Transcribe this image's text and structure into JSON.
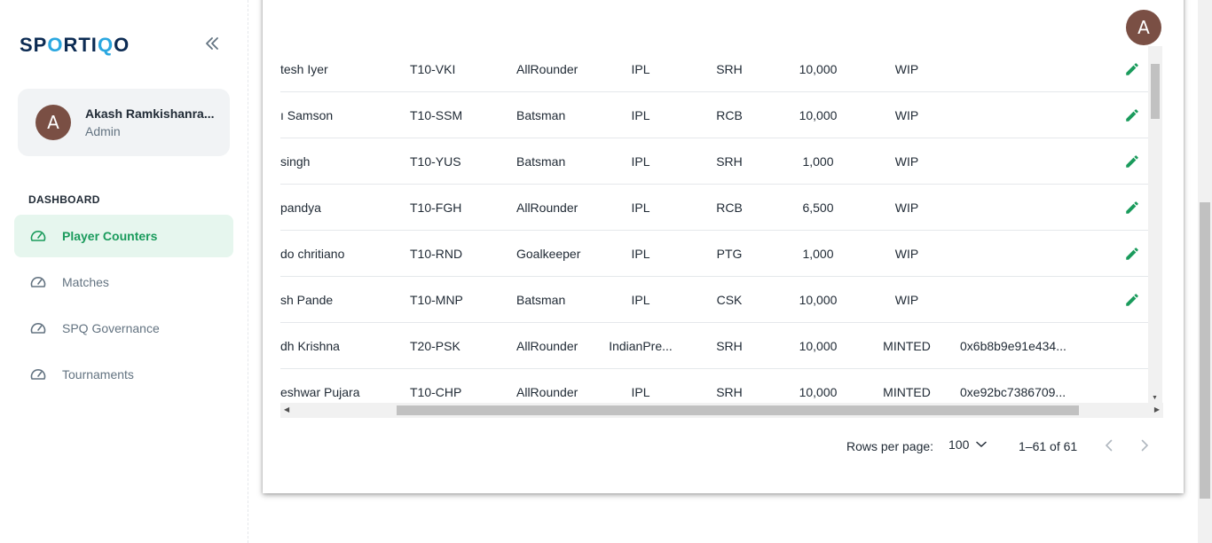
{
  "brand": {
    "logo_part1": "SP",
    "logo_accent": "O",
    "logo_part2": "RTI",
    "logo_accent2": "Q",
    "logo_part3": "O"
  },
  "user": {
    "avatar_letter": "A",
    "name": "Akash Ramkishanra...",
    "role": "Admin"
  },
  "nav": {
    "section": "DASHBOARD",
    "items": [
      {
        "label": "Player Counters",
        "icon": "speedometer-icon",
        "active": true
      },
      {
        "label": "Matches",
        "icon": "speedometer-icon",
        "active": false
      },
      {
        "label": "SPQ Governance",
        "icon": "speedometer-icon",
        "active": false
      },
      {
        "label": "Tournaments",
        "icon": "speedometer-icon",
        "active": false
      }
    ]
  },
  "table": {
    "rows": [
      {
        "name": "tesh Iyer",
        "code": "T10-VKI",
        "role": "AllRounder",
        "league": "IPL",
        "team": "SRH",
        "value": "10,000",
        "status": "WIP",
        "hash": "",
        "editable": true
      },
      {
        "name": "ı Samson",
        "code": "T10-SSM",
        "role": "Batsman",
        "league": "IPL",
        "team": "RCB",
        "value": "10,000",
        "status": "WIP",
        "hash": "",
        "editable": true
      },
      {
        "name": "singh",
        "code": "T10-YUS",
        "role": "Batsman",
        "league": "IPL",
        "team": "SRH",
        "value": "1,000",
        "status": "WIP",
        "hash": "",
        "editable": true
      },
      {
        "name": "pandya",
        "code": "T10-FGH",
        "role": "AllRounder",
        "league": "IPL",
        "team": "RCB",
        "value": "6,500",
        "status": "WIP",
        "hash": "",
        "editable": true
      },
      {
        "name": "do chritiano",
        "code": "T10-RND",
        "role": "Goalkeeper",
        "league": "IPL",
        "team": "PTG",
        "value": "1,000",
        "status": "WIP",
        "hash": "",
        "editable": true
      },
      {
        "name": "sh Pande",
        "code": "T10-MNP",
        "role": "Batsman",
        "league": "IPL",
        "team": "CSK",
        "value": "10,000",
        "status": "WIP",
        "hash": "",
        "editable": true
      },
      {
        "name": "dh Krishna",
        "code": "T20-PSK",
        "role": "AllRounder",
        "league": "IndianPre...",
        "team": "SRH",
        "value": "10,000",
        "status": "MINTED",
        "hash": "0x6b8b9e91e434...",
        "editable": false
      },
      {
        "name": "eshwar Pujara",
        "code": "T10-CHP",
        "role": "AllRounder",
        "league": "IPL",
        "team": "SRH",
        "value": "10,000",
        "status": "MINTED",
        "hash": "0xe92bc7386709...",
        "editable": false
      }
    ]
  },
  "pagination": {
    "rows_per_page_label": "Rows per page:",
    "rows_per_page_value": "100",
    "range": "1–61 of 61"
  },
  "header": {
    "avatar_letter": "A"
  },
  "colors": {
    "accent": "#1a9b5c",
    "active_bg": "#e6f6ee",
    "avatar": "#7a4f44",
    "logo": "#0c2b53",
    "logo_accent": "#2aa7e0"
  }
}
